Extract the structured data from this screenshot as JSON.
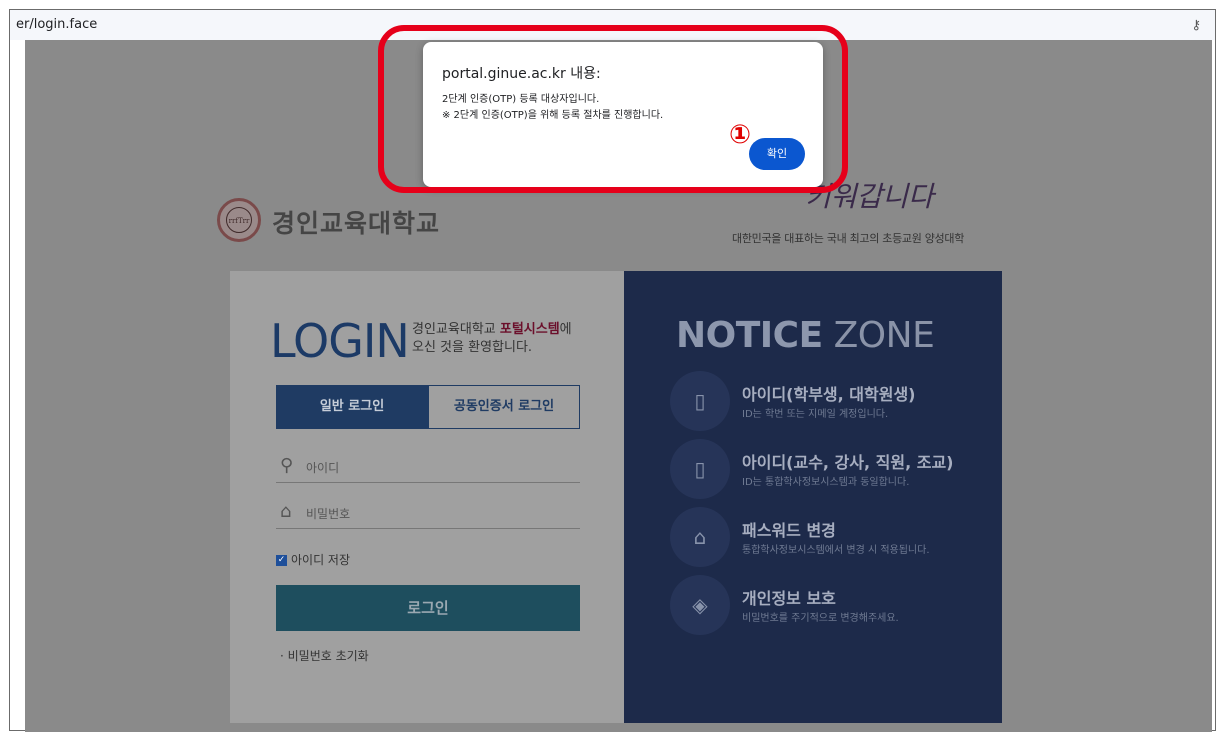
{
  "browser": {
    "url": "er/login.face",
    "key_icon": "key-icon"
  },
  "page": {
    "university_name": "경인교육대학교",
    "logo_text": "rrfTrr",
    "slogan_script": "키워갑니다",
    "slogan_sub": "대한민국을 대표하는 국내 최고의 초등교원 양성대학",
    "login": {
      "title": "LOGIN",
      "welcome_prefix": "경인교육대학교 ",
      "welcome_highlight": "포털시스템",
      "welcome_suffix": "에",
      "welcome_line2": "오신 것을 환영합니다.",
      "tab_normal": "일반 로그인",
      "tab_cert": "공동인증서 로그인",
      "id_placeholder": "아이디",
      "pw_placeholder": "비밀번호",
      "save_id_label": "아이디 저장",
      "save_id_checked": true,
      "login_button": "로그인",
      "pw_reset": "· 비밀번호 초기화"
    },
    "notice": {
      "title_bold": "NOTICE",
      "title_light": " ZONE",
      "items": [
        {
          "title": "아이디(학부생, 대학원생)",
          "desc": "ID는 학번 또는 지메일 계정입니다.",
          "icon": "id-card-icon"
        },
        {
          "title": "아이디(교수, 강사, 직원, 조교)",
          "desc": "ID는 통합학사정보시스템과 동일합니다.",
          "icon": "id-card-icon"
        },
        {
          "title": "패스워드 변경",
          "desc": "통합학사정보시스템에서 변경 시 적용됩니다.",
          "icon": "lock-icon"
        },
        {
          "title": "개인정보 보호",
          "desc": "비밀번호를 주기적으로 변경해주세요.",
          "icon": "shield-icon"
        }
      ]
    }
  },
  "dialog": {
    "origin": "portal.ginue.ac.kr 내용:",
    "message_line1": "2단계 인증(OTP) 등록 대상자입니다.",
    "message_line2": "※ 2단계 인증(OTP)을 위해 등록 절차를 진행합니다.",
    "ok_button": "확인"
  },
  "annotation": {
    "step_marker": "①",
    "highlight_color": "#e6001a"
  }
}
